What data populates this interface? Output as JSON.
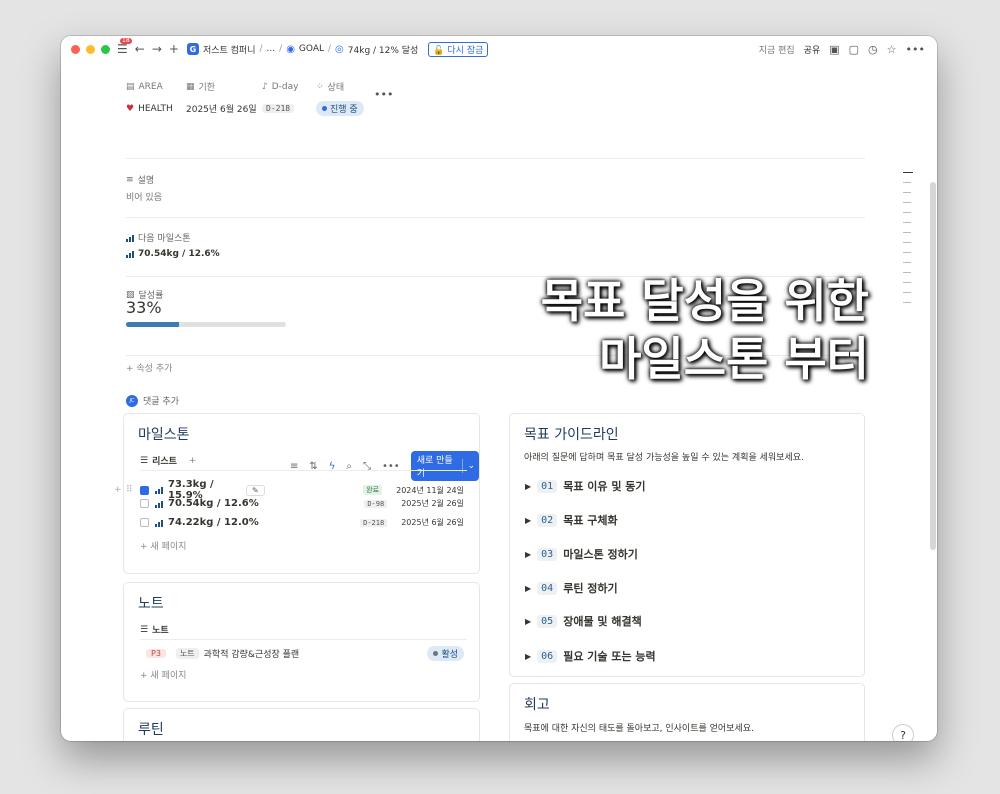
{
  "topbar": {
    "notif_count": "18",
    "crumbs": [
      "저스트 컴퍼니",
      "...",
      "GOAL",
      "74kg / 12% 달성"
    ],
    "relock": "다시 잠금",
    "edited": "지금 편집",
    "share": "공유"
  },
  "props": {
    "area_label": "AREA",
    "deadline_label": "기한",
    "dday_label": "D-day",
    "status_label": "상태",
    "area_value": "HEALTH",
    "deadline_value": "2025년 6월 26일",
    "dday_value": "D-218",
    "status_value": "진행 중"
  },
  "sections": {
    "desc_label": "설명",
    "desc_value": "비어 있음",
    "next_ms_label": "다음 마일스톤",
    "next_ms_value": "70.54kg / 12.6%",
    "progress_label": "달성률",
    "progress_value": "33%",
    "progress_fraction": 0.33,
    "add_prop": "속성 추가",
    "add_comment": "댓글 추가"
  },
  "overlay": {
    "line1": "목표 달성을 위한",
    "line2": "마일스톤 부터"
  },
  "milestones": {
    "title": "마일스톤",
    "view": "리스트",
    "new_btn": "새로 만들기",
    "rows": [
      {
        "name": "73.3kg / 15.9%",
        "tag": "완료",
        "date": "2024년 11월 24일",
        "checked": true
      },
      {
        "name": "70.54kg / 12.6%",
        "tag": "D-98",
        "date": "2025년 2월 26일",
        "checked": false
      },
      {
        "name": "74.22kg / 12.0%",
        "tag": "D-218",
        "date": "2025년 6월 26일",
        "checked": false
      }
    ],
    "new_page": "새 페이지"
  },
  "notes": {
    "title": "노트",
    "view": "노트",
    "row": {
      "priority": "P3",
      "type": "노트",
      "name": "과학적 감량&근성장 플랜",
      "status": "활성"
    },
    "new_page": "새 페이지"
  },
  "routine": {
    "title": "루틴"
  },
  "guide": {
    "title": "목표 가이드라인",
    "desc": "아래의 질문에 답하며 목표 달성 가능성을 높일 수 있는 계획을 세워보세요.",
    "items": [
      {
        "num": "01",
        "label": "목표 이유 및 동기"
      },
      {
        "num": "02",
        "label": "목표 구체화"
      },
      {
        "num": "03",
        "label": "마일스톤 정하기"
      },
      {
        "num": "04",
        "label": "루틴 정하기"
      },
      {
        "num": "05",
        "label": "장애물 및 해결책"
      },
      {
        "num": "06",
        "label": "필요 기술 또는 능력"
      }
    ]
  },
  "review": {
    "title": "회고",
    "desc": "목표에 대한 자신의 태도를 돌아보고, 인사이트를 얻어보세요."
  },
  "colors": {
    "accent": "#2f6be5",
    "heading": "#1f3b5c",
    "progress": "#3d7bb0"
  }
}
